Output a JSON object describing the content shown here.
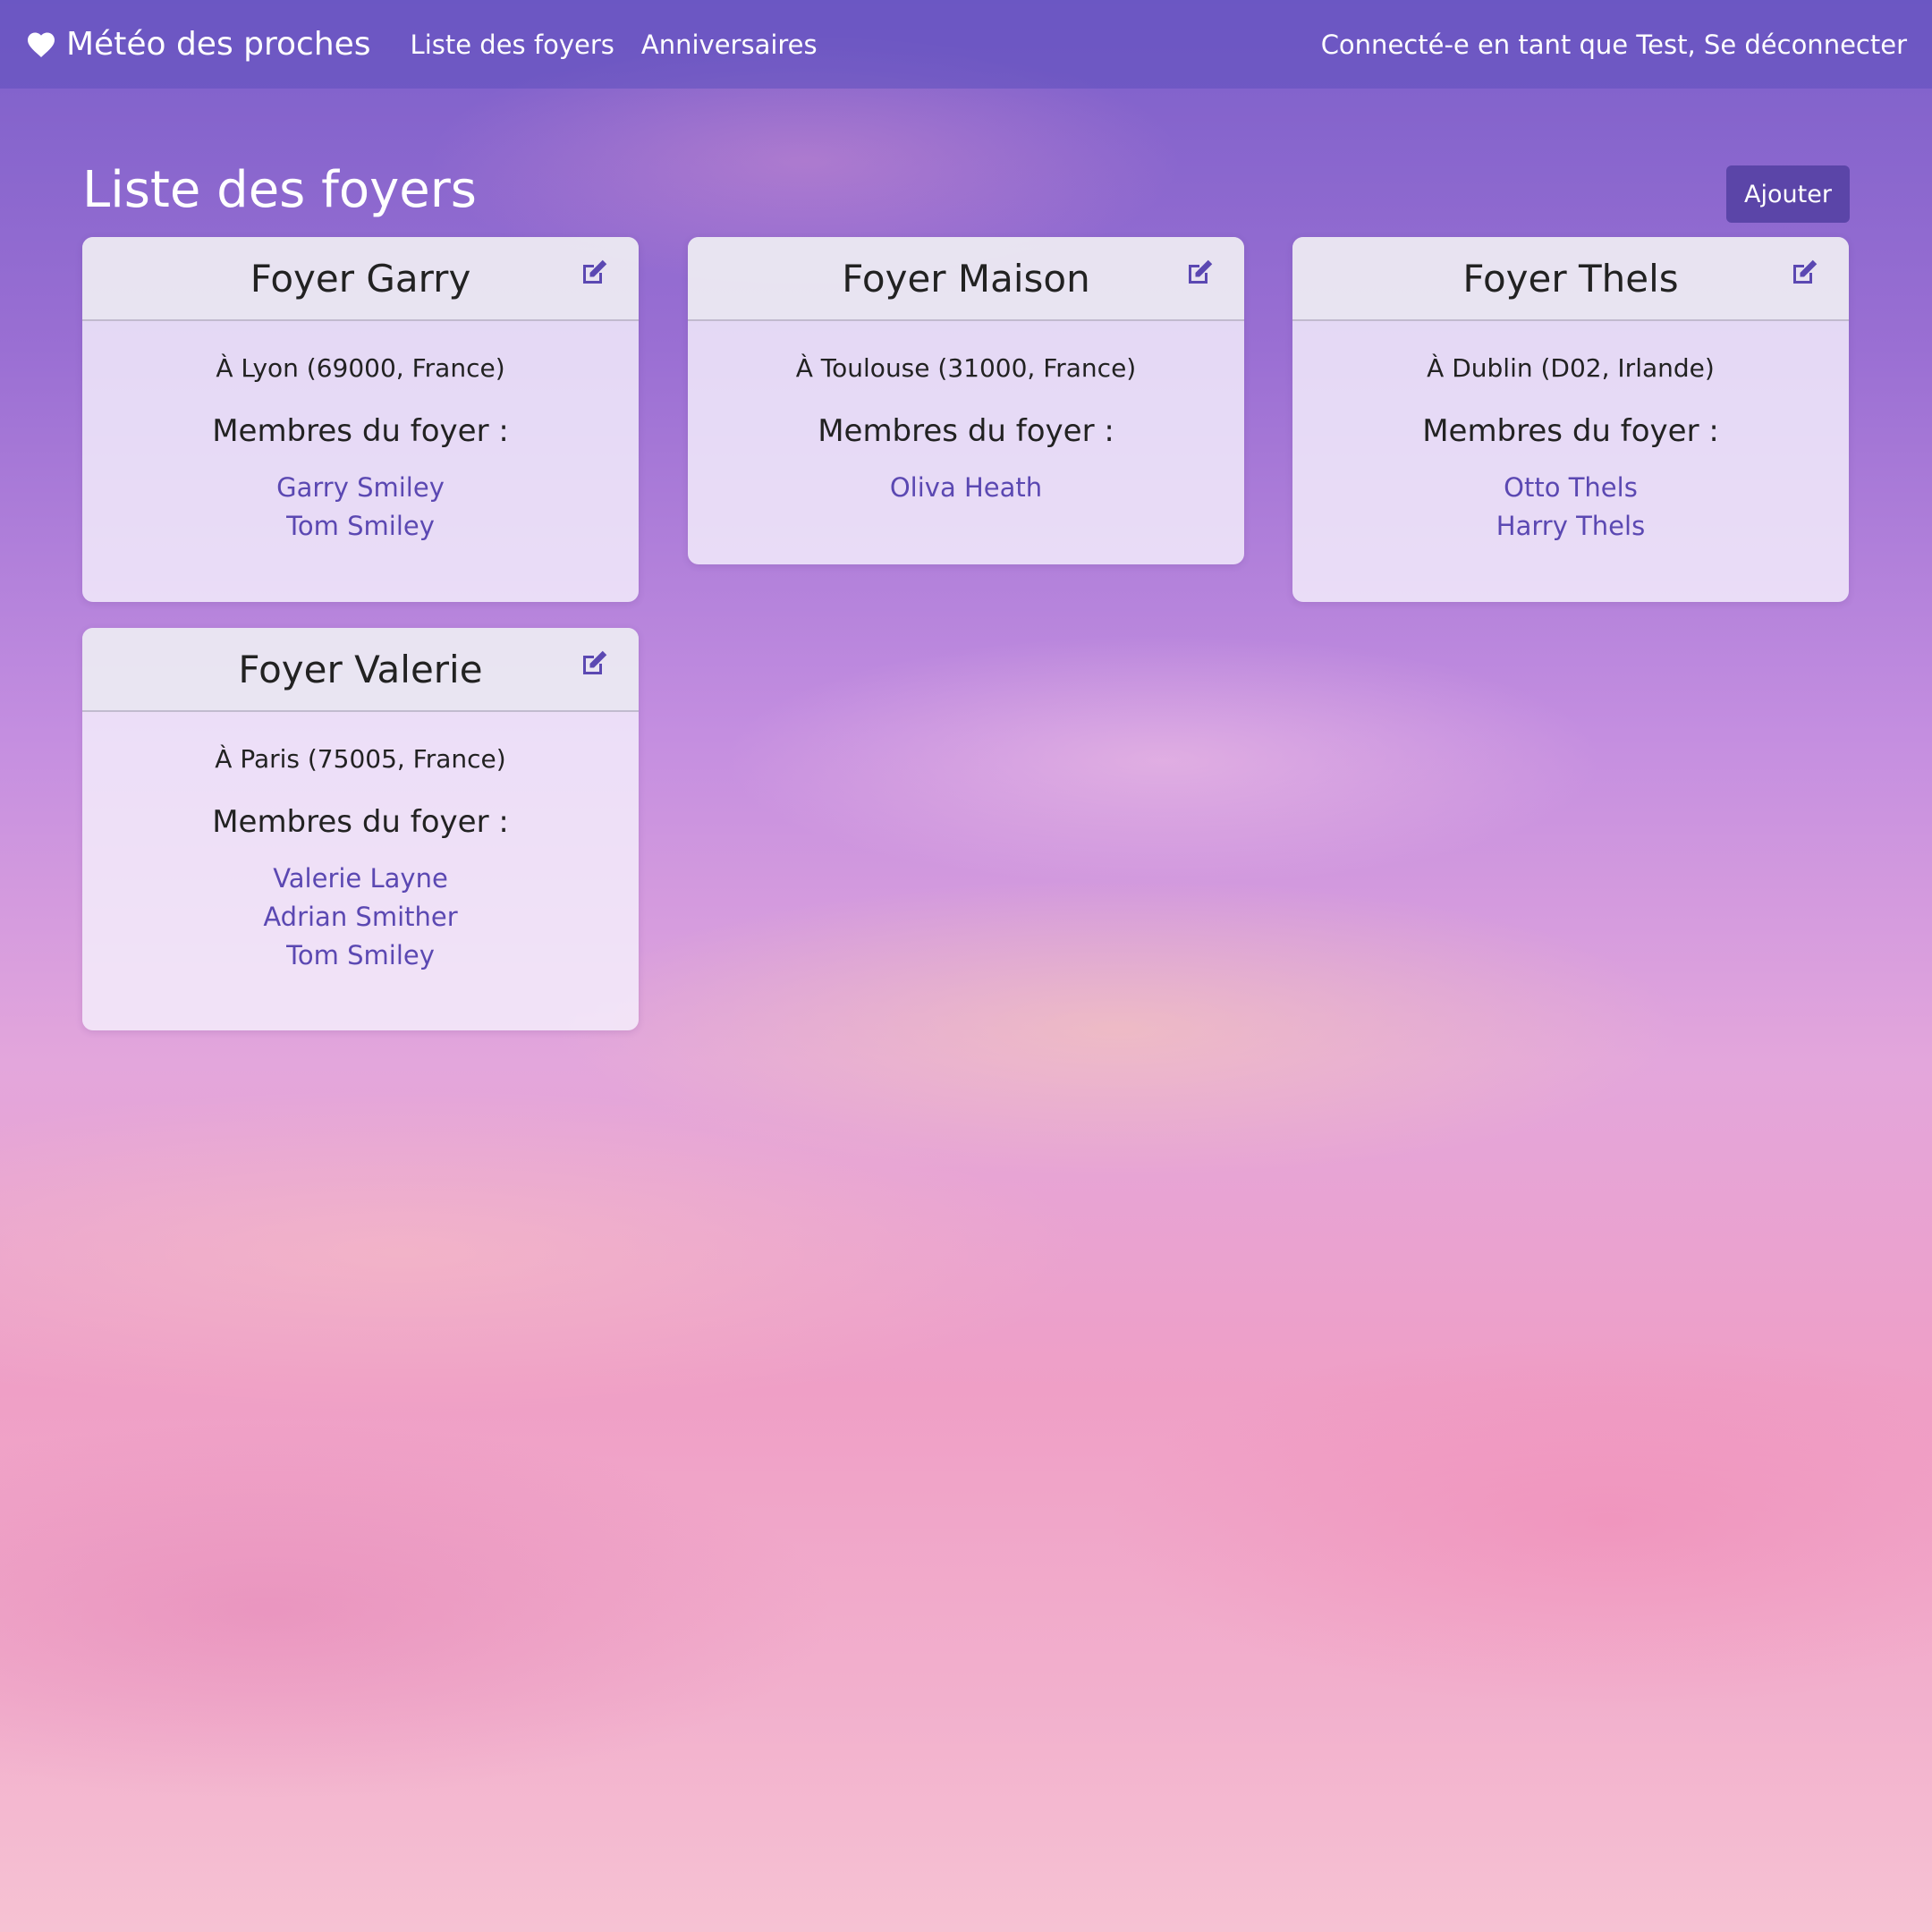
{
  "navbar": {
    "brand": "Météo des proches",
    "links": [
      "Liste des foyers",
      "Anniversaires"
    ],
    "user_text": "Connecté-e en tant que Test,",
    "logout": "Se déconnecter"
  },
  "page": {
    "title": "Liste des foyers",
    "add_label": "Ajouter"
  },
  "households": [
    {
      "title": "Foyer Garry",
      "address": "À Lyon (69000, France)",
      "members_heading": "Membres du foyer :",
      "members": [
        "Garry Smiley",
        "Tom Smiley"
      ]
    },
    {
      "title": "Foyer Maison",
      "address": "À Toulouse (31000, France)",
      "members_heading": "Membres du foyer :",
      "members": [
        "Oliva Heath"
      ]
    },
    {
      "title": "Foyer Thels",
      "address": "À Dublin (D02, Irlande)",
      "members_heading": "Membres du foyer :",
      "members": [
        "Otto Thels",
        "Harry Thels"
      ]
    },
    {
      "title": "Foyer Valerie",
      "address": "À Paris (75005, France)",
      "members_heading": "Membres du foyer :",
      "members": [
        "Valerie Layne",
        "Adrian Smither",
        "Tom Smiley"
      ]
    }
  ],
  "icons": {
    "brand": "heart-icon",
    "edit": "edit-icon"
  },
  "colors": {
    "navbar": "#5f50be",
    "accent_button": "#5b45a8",
    "member_link": "#5b48b2"
  }
}
